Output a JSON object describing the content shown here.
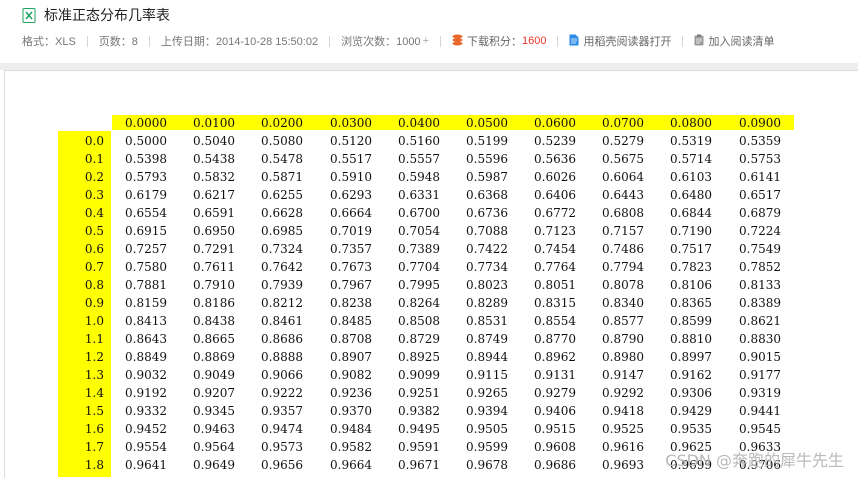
{
  "header": {
    "title": "标准正态分布几率表",
    "format_label": "格式：XLS",
    "pages_label": "页数：8",
    "upload_label": "上传日期：2014-10-28 15:50:02",
    "views_label": "浏览次数：1000",
    "views_plus": "+",
    "points_label": "下载积分：",
    "points_value": "1600",
    "open_reader": "用稻壳阅读器打开",
    "add_reading_list": "加入阅读清单"
  },
  "colors": {
    "highlight": "#ffff00",
    "points_red": "#e8362b",
    "xls_green": "#21a366",
    "reader_blue": "#2b8be6",
    "stack_orange": "#e8682b"
  },
  "icons": [
    "xls-icon",
    "coins-icon",
    "document-icon",
    "clipboard-icon"
  ],
  "table": {
    "col_headers": [
      "0.0000",
      "0.0100",
      "0.0200",
      "0.0300",
      "0.0400",
      "0.0500",
      "0.0600",
      "0.0700",
      "0.0800",
      "0.0900"
    ],
    "rows": [
      {
        "label": "0.0",
        "values": [
          "0.5000",
          "0.5040",
          "0.5080",
          "0.5120",
          "0.5160",
          "0.5199",
          "0.5239",
          "0.5279",
          "0.5319",
          "0.5359"
        ]
      },
      {
        "label": "0.1",
        "values": [
          "0.5398",
          "0.5438",
          "0.5478",
          "0.5517",
          "0.5557",
          "0.5596",
          "0.5636",
          "0.5675",
          "0.5714",
          "0.5753"
        ]
      },
      {
        "label": "0.2",
        "values": [
          "0.5793",
          "0.5832",
          "0.5871",
          "0.5910",
          "0.5948",
          "0.5987",
          "0.6026",
          "0.6064",
          "0.6103",
          "0.6141"
        ]
      },
      {
        "label": "0.3",
        "values": [
          "0.6179",
          "0.6217",
          "0.6255",
          "0.6293",
          "0.6331",
          "0.6368",
          "0.6406",
          "0.6443",
          "0.6480",
          "0.6517"
        ]
      },
      {
        "label": "0.4",
        "values": [
          "0.6554",
          "0.6591",
          "0.6628",
          "0.6664",
          "0.6700",
          "0.6736",
          "0.6772",
          "0.6808",
          "0.6844",
          "0.6879"
        ]
      },
      {
        "label": "0.5",
        "values": [
          "0.6915",
          "0.6950",
          "0.6985",
          "0.7019",
          "0.7054",
          "0.7088",
          "0.7123",
          "0.7157",
          "0.7190",
          "0.7224"
        ]
      },
      {
        "label": "0.6",
        "values": [
          "0.7257",
          "0.7291",
          "0.7324",
          "0.7357",
          "0.7389",
          "0.7422",
          "0.7454",
          "0.7486",
          "0.7517",
          "0.7549"
        ]
      },
      {
        "label": "0.7",
        "values": [
          "0.7580",
          "0.7611",
          "0.7642",
          "0.7673",
          "0.7704",
          "0.7734",
          "0.7764",
          "0.7794",
          "0.7823",
          "0.7852"
        ]
      },
      {
        "label": "0.8",
        "values": [
          "0.7881",
          "0.7910",
          "0.7939",
          "0.7967",
          "0.7995",
          "0.8023",
          "0.8051",
          "0.8078",
          "0.8106",
          "0.8133"
        ]
      },
      {
        "label": "0.9",
        "values": [
          "0.8159",
          "0.8186",
          "0.8212",
          "0.8238",
          "0.8264",
          "0.8289",
          "0.8315",
          "0.8340",
          "0.8365",
          "0.8389"
        ]
      },
      {
        "label": "1.0",
        "values": [
          "0.8413",
          "0.8438",
          "0.8461",
          "0.8485",
          "0.8508",
          "0.8531",
          "0.8554",
          "0.8577",
          "0.8599",
          "0.8621"
        ]
      },
      {
        "label": "1.1",
        "values": [
          "0.8643",
          "0.8665",
          "0.8686",
          "0.8708",
          "0.8729",
          "0.8749",
          "0.8770",
          "0.8790",
          "0.8810",
          "0.8830"
        ]
      },
      {
        "label": "1.2",
        "values": [
          "0.8849",
          "0.8869",
          "0.8888",
          "0.8907",
          "0.8925",
          "0.8944",
          "0.8962",
          "0.8980",
          "0.8997",
          "0.9015"
        ]
      },
      {
        "label": "1.3",
        "values": [
          "0.9032",
          "0.9049",
          "0.9066",
          "0.9082",
          "0.9099",
          "0.9115",
          "0.9131",
          "0.9147",
          "0.9162",
          "0.9177"
        ]
      },
      {
        "label": "1.4",
        "values": [
          "0.9192",
          "0.9207",
          "0.9222",
          "0.9236",
          "0.9251",
          "0.9265",
          "0.9279",
          "0.9292",
          "0.9306",
          "0.9319"
        ]
      },
      {
        "label": "1.5",
        "values": [
          "0.9332",
          "0.9345",
          "0.9357",
          "0.9370",
          "0.9382",
          "0.9394",
          "0.9406",
          "0.9418",
          "0.9429",
          "0.9441"
        ]
      },
      {
        "label": "1.6",
        "values": [
          "0.9452",
          "0.9463",
          "0.9474",
          "0.9484",
          "0.9495",
          "0.9505",
          "0.9515",
          "0.9525",
          "0.9535",
          "0.9545"
        ]
      },
      {
        "label": "1.7",
        "values": [
          "0.9554",
          "0.9564",
          "0.9573",
          "0.9582",
          "0.9591",
          "0.9599",
          "0.9608",
          "0.9616",
          "0.9625",
          "0.9633"
        ]
      },
      {
        "label": "1.8",
        "values": [
          "0.9641",
          "0.9649",
          "0.9656",
          "0.9664",
          "0.9671",
          "0.9678",
          "0.9686",
          "0.9693",
          "0.9699",
          "0.9706"
        ]
      }
    ]
  },
  "watermark": "CSDN @奔跑的犀牛先生"
}
